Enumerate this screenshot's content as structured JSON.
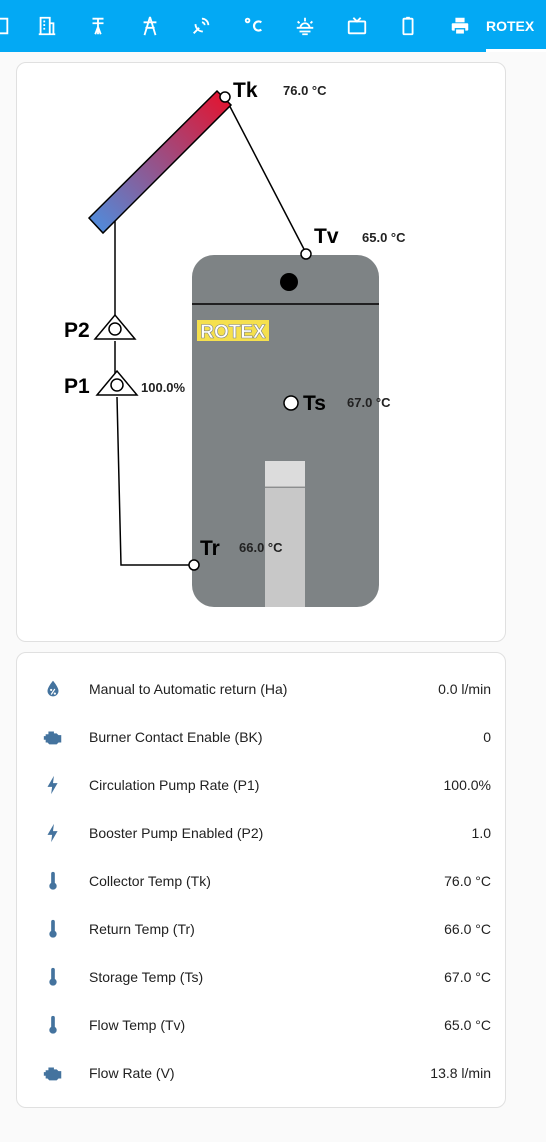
{
  "colors": {
    "header": "#03a9f4",
    "icon": "#44739e",
    "tank": "#7e8385",
    "logo_bg": "#f5e04e"
  },
  "tabs": {
    "icons": [
      "chart-icon",
      "office-building-icon",
      "transmission-tower-icon",
      "power-pylon-icon",
      "satellite-dish-icon",
      "celsius-icon",
      "sunset-icon",
      "television-icon",
      "battery-icon",
      "printer-icon"
    ],
    "active_label": "ROTEX"
  },
  "diagram": {
    "logo": "ROTEX",
    "sensors": {
      "tk": {
        "label": "Tk",
        "value": "76.0 °C"
      },
      "tv": {
        "label": "Tv",
        "value": "65.0 °C"
      },
      "ts": {
        "label": "Ts",
        "value": "67.0 °C"
      },
      "tr": {
        "label": "Tr",
        "value": "66.0 °C"
      }
    },
    "pumps": {
      "p2": {
        "label": "P2"
      },
      "p1": {
        "label": "P1",
        "value": "100.0%"
      }
    }
  },
  "entities": [
    {
      "icon": "water-percent-icon",
      "name": "Manual to Automatic return (Ha)",
      "value": "0.0 l/min"
    },
    {
      "icon": "engine-icon",
      "name": "Burner Contact Enable (BK)",
      "value": "0"
    },
    {
      "icon": "flash-icon",
      "name": "Circulation Pump Rate (P1)",
      "value": "100.0%"
    },
    {
      "icon": "flash-icon",
      "name": "Booster Pump Enabled (P2)",
      "value": "1.0"
    },
    {
      "icon": "thermometer-icon",
      "name": "Collector Temp (Tk)",
      "value": "76.0 °C"
    },
    {
      "icon": "thermometer-icon",
      "name": "Return Temp (Tr)",
      "value": "66.0 °C"
    },
    {
      "icon": "thermometer-icon",
      "name": "Storage Temp (Ts)",
      "value": "67.0 °C"
    },
    {
      "icon": "thermometer-icon",
      "name": "Flow Temp (Tv)",
      "value": "65.0 °C"
    },
    {
      "icon": "engine-icon",
      "name": "Flow Rate (V)",
      "value": "13.8 l/min"
    }
  ]
}
